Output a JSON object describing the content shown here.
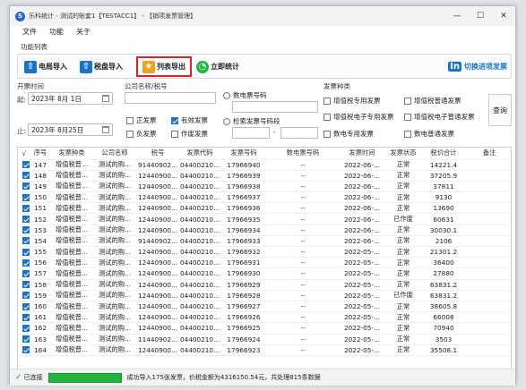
{
  "window": {
    "title": "乐科统计 - 测试的账套1【TESTACC1】 - 【销项发票管理】",
    "app_icon": "S"
  },
  "menu": [
    "文件",
    "功能",
    "关于"
  ],
  "toolbar_label": "功能列表",
  "toolbar": {
    "import_electronic": "电局导入",
    "import_taxdisk": "税盘导入",
    "export_list": "列表导出",
    "stat_now": "立即统计",
    "switch_mode": "切换进项发票",
    "switch_badge": "In"
  },
  "filters": {
    "issue_time_label": "开票时间",
    "start_label": "起:",
    "start_date": "2023年  8月  1日",
    "end_label": "止:",
    "end_date": "2023年  8月25日",
    "company_label": "公司名称/税号",
    "status_options": [
      {
        "label": "正发票",
        "checked": false
      },
      {
        "label": "有效发票",
        "checked": true
      },
      {
        "label": "负发票",
        "checked": false
      },
      {
        "label": "作废发票",
        "checked": false
      }
    ],
    "radio_digital_no": "数电票号码",
    "radio_range": "检索发票号码段",
    "range_separator": "-",
    "type_label": "发票种类",
    "types": [
      "增值税专用发票",
      "增值税普通发票",
      "增值税电子专用发票",
      "增值税电子普通发票",
      "数电专用发票",
      "数电普通发票"
    ],
    "query_button": "查询"
  },
  "table": {
    "columns": [
      "√",
      "序号",
      "发票种类",
      "公司名称",
      "税号",
      "发票代码",
      "发票号码",
      "数电票号码",
      "发票时间",
      "发票状态",
      "税价合计",
      "备注"
    ],
    "rows": [
      [
        "147",
        "增值税普...",
        "测试的购...",
        "91440902...",
        "04400210...",
        "17966940",
        "--",
        "2022-06-...",
        "正常",
        "14221.4",
        ""
      ],
      [
        "148",
        "增值税普...",
        "测试的购...",
        "12440900...",
        "04400210...",
        "17966939",
        "--",
        "2022-06-...",
        "正常",
        "37205.9",
        ""
      ],
      [
        "149",
        "增值税普...",
        "测试的购...",
        "12440900...",
        "04400210...",
        "17966938",
        "--",
        "2022-06-...",
        "正常",
        "37811",
        ""
      ],
      [
        "150",
        "增值税普...",
        "测试的购...",
        "12440900...",
        "04400210...",
        "17966937",
        "--",
        "2022-06-...",
        "正常",
        "9130",
        ""
      ],
      [
        "151",
        "增值税普...",
        "测试的购...",
        "12440900...",
        "04400210...",
        "17966936",
        "--",
        "2022-06-...",
        "正常",
        "13690",
        ""
      ],
      [
        "152",
        "增值税普...",
        "测试的购...",
        "12440900...",
        "04400210...",
        "17966935",
        "--",
        "2022-06-...",
        "已作废",
        "60631",
        ""
      ],
      [
        "153",
        "增值税普...",
        "测试的购...",
        "12440900...",
        "04400210...",
        "17966934",
        "--",
        "2022-06-...",
        "正常",
        "30030.1",
        ""
      ],
      [
        "154",
        "增值税普...",
        "测试的购...",
        "91440902...",
        "04400210...",
        "17966933",
        "--",
        "2022-06-...",
        "正常",
        "2106",
        ""
      ],
      [
        "155",
        "增值税普...",
        "测试的购...",
        "12440900...",
        "04400210...",
        "17966932",
        "--",
        "2022-05-...",
        "正常",
        "21301.2",
        ""
      ],
      [
        "156",
        "增值税普...",
        "测试的购...",
        "12440900...",
        "04400210...",
        "17966931",
        "--",
        "2022-05-...",
        "正常",
        "36400",
        ""
      ],
      [
        "157",
        "增值税普...",
        "测试的购...",
        "12440900...",
        "04400210...",
        "17966930",
        "--",
        "2022-05-...",
        "正常",
        "27880",
        ""
      ],
      [
        "158",
        "增值税普...",
        "测试的购...",
        "12440900...",
        "04400210...",
        "17966929",
        "--",
        "2022-05-...",
        "正常",
        "63831.2",
        ""
      ],
      [
        "159",
        "增值税普...",
        "测试的购...",
        "12440900...",
        "04400210...",
        "17966928",
        "--",
        "2022-05-...",
        "已作废",
        "63831.2",
        ""
      ],
      [
        "160",
        "增值税普...",
        "测试的购...",
        "12440900...",
        "04400210...",
        "17966927",
        "--",
        "2022-05-...",
        "正常",
        "38605.8",
        ""
      ],
      [
        "161",
        "增值税普...",
        "测试的购...",
        "12440900...",
        "04400210...",
        "17966926",
        "--",
        "2022-05-...",
        "正常",
        "66008",
        ""
      ],
      [
        "162",
        "增值税普...",
        "测试的购...",
        "12440900...",
        "04400210...",
        "17966925",
        "--",
        "2022-05-...",
        "正常",
        "70940",
        ""
      ],
      [
        "163",
        "增值税普...",
        "测试的购...",
        "11440902...",
        "04400210...",
        "17966924",
        "--",
        "2022-05-...",
        "正常",
        "3503",
        ""
      ],
      [
        "164",
        "增值税普...",
        "测试的购...",
        "12440900...",
        "04400210...",
        "17966923",
        "--",
        "2022-05-...",
        "正常",
        "35508.1",
        ""
      ]
    ]
  },
  "status": {
    "connection": "已连接",
    "message": "成功导入175张发票，价税金额为4316150.54元，共处理815条数据",
    "progress": 1.0
  }
}
